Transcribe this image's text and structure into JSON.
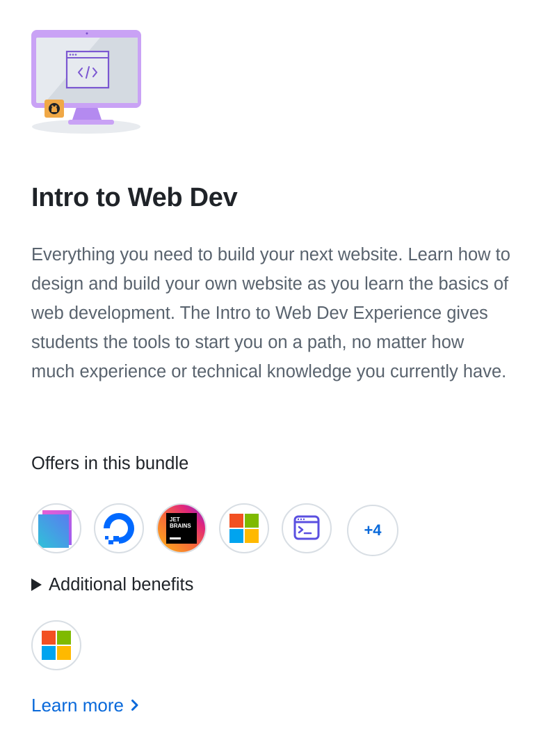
{
  "bundle": {
    "title": "Intro to Web Dev",
    "description": "Everything you need to build your next website. Learn how to design and build your own website as you learn the basics of web development. The Intro to Web Dev Experience gives students the tools to start you on a path, no matter how much experience or technical knowledge you currently have."
  },
  "offers": {
    "heading": "Offers in this bundle",
    "items": [
      {
        "icon": "gradient-layers-icon"
      },
      {
        "icon": "digitalocean-icon"
      },
      {
        "icon": "jetbrains-icon",
        "label_line1": "JET",
        "label_line2": "BRAINS"
      },
      {
        "icon": "microsoft-icon"
      },
      {
        "icon": "terminal-window-icon"
      }
    ],
    "more_label": "+4"
  },
  "benefits": {
    "label": "Additional benefits",
    "items": [
      {
        "icon": "microsoft-icon"
      }
    ]
  },
  "learn_more": {
    "label": "Learn more"
  },
  "colors": {
    "link": "#0969da",
    "monitor": "#c9a2f5",
    "github_badge": "#f0a846",
    "muted_text": "#59636e"
  }
}
